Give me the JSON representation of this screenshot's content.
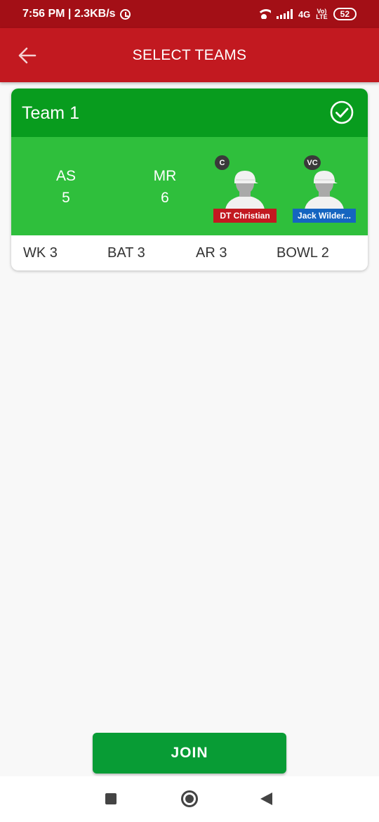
{
  "status_bar": {
    "time_speed": "7:56 PM | 2.3KB/s",
    "network": "4G",
    "volte_top": "Vo)",
    "volte_bottom": "LTE",
    "battery": "52",
    "icons": [
      "alarm-icon",
      "wifi-icon",
      "signal-icon",
      "battery-icon"
    ]
  },
  "app_bar": {
    "title": "SELECT TEAMS",
    "back_icon": "arrow-left-icon"
  },
  "team": {
    "name": "Team 1",
    "selected_icon": "check-circle-icon",
    "teams": [
      {
        "code": "AS",
        "count": "5"
      },
      {
        "code": "MR",
        "count": "6"
      }
    ],
    "captain": {
      "badge": "C",
      "name": "DT Christian"
    },
    "vice_captain": {
      "badge": "VC",
      "name": "Jack Wilder..."
    },
    "composition": {
      "wk": "WK 3",
      "bat": "BAT 3",
      "ar": "AR 3",
      "bowl": "BOWL 2"
    }
  },
  "join_label": "JOIN",
  "colors": {
    "status_bar": "#a30f16",
    "app_bar": "#c21920",
    "team_header": "#089c1e",
    "team_body": "#2fbf3c",
    "join_button": "#089c35",
    "captain_label": "#c21920",
    "vice_captain_label": "#1565c0"
  },
  "nav_icons": [
    "recent-apps-icon",
    "home-icon",
    "back-triangle-icon"
  ]
}
